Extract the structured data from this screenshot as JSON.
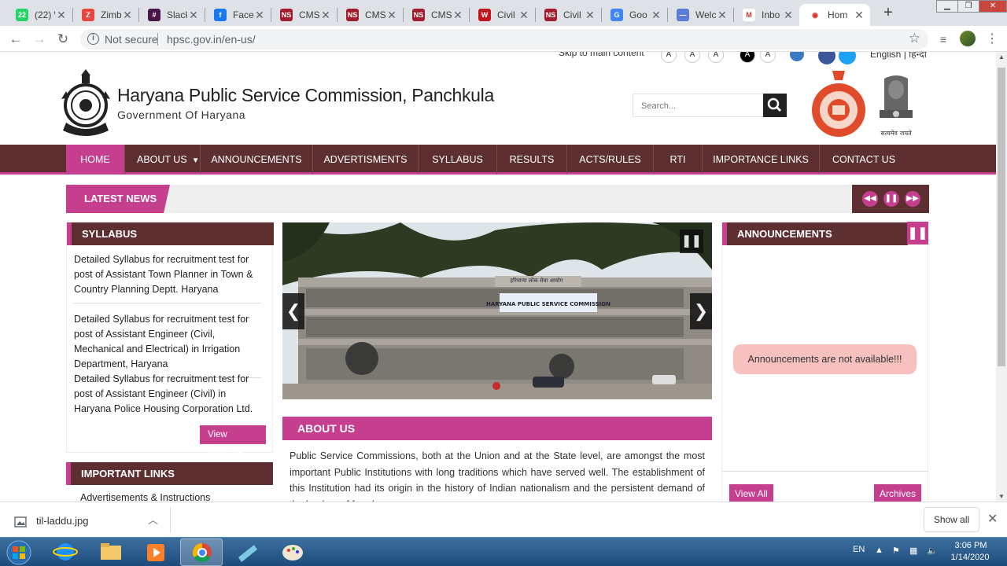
{
  "browser": {
    "tabs": [
      {
        "label": "(22) \\",
        "favicon_color": "#25d366",
        "favicon_text": "22"
      },
      {
        "label": "Zimb",
        "favicon_color": "#e8453c",
        "favicon_text": "Z"
      },
      {
        "label": "Slack",
        "favicon_color": "#4a154b",
        "favicon_text": "#"
      },
      {
        "label": "Facel",
        "favicon_color": "#1877f2",
        "favicon_text": "f"
      },
      {
        "label": "CMS",
        "favicon_color": "#a01c2c",
        "favicon_text": "NS"
      },
      {
        "label": "CMS",
        "favicon_color": "#a01c2c",
        "favicon_text": "NS"
      },
      {
        "label": "CMS",
        "favicon_color": "#a01c2c",
        "favicon_text": "NS"
      },
      {
        "label": "Civil",
        "favicon_color": "#c0161c",
        "favicon_text": "W"
      },
      {
        "label": "Civil",
        "favicon_color": "#a01c2c",
        "favicon_text": "NS"
      },
      {
        "label": "Goo",
        "favicon_color": "#4285f4",
        "favicon_text": "G"
      },
      {
        "label": "Welc",
        "favicon_color": "#5b7bd5",
        "favicon_text": "—"
      },
      {
        "label": "Inbo",
        "favicon_color": "#ffffff",
        "favicon_text": "M"
      },
      {
        "label": "Hom",
        "favicon_color": "#ffffff",
        "favicon_text": "◉"
      }
    ],
    "active_tab_index": 12,
    "address": {
      "security_label": "Not secure",
      "url": "hpsc.gov.in/en-us/"
    }
  },
  "site": {
    "topbar": {
      "skip_link": "Skip to main content",
      "font_buttons": [
        "A",
        "A",
        "A",
        "A",
        "A"
      ],
      "language": "English | हिन्दी"
    },
    "title": "Haryana Public Service Commission, Panchkula",
    "subtitle": "Government Of Haryana",
    "search_placeholder": "Search...",
    "emblem_caption": "सत्यमेव जयते",
    "nav": [
      "HOME",
      "ABOUT US",
      "ANNOUNCEMENTS",
      "ADVERTISMENTS",
      "SYLLABUS",
      "RESULTS",
      "ACTS/RULES",
      "RTI",
      "IMPORTANCE LINKS",
      "CONTACT US"
    ],
    "latest_news_label": "LATEST NEWS",
    "syllabus": {
      "heading": "SYLLABUS",
      "items": [
        "Detailed Syllabus for recruitment test for post of Assistant Town Planner in Town & Country Planning Deptt. Haryana",
        "Detailed Syllabus for recruitment test for post of Assistant Engineer (Civil, Mechanical and Electrical) in Irrigation Department, Haryana",
        "Detailed Syllabus for recruitment test for post of Assistant Engineer (Civil) in Haryana Police Housing Corporation Ltd."
      ],
      "view_more": "View More"
    },
    "important_links": {
      "heading": "IMPORTANT LINKS",
      "items": [
        "Advertisements & Instructions"
      ]
    },
    "slider": {
      "building_sign_hi": "हरियाणा लोक सेवा आयोग",
      "building_sign_en": "HARYANA PUBLIC SERVICE COMMISSION"
    },
    "about": {
      "heading": "ABOUT US",
      "text": "Public Service Commissions, both at the Union and at the State level, are amongst the most important Public Institutions with long traditions which have served well. The establishment of this Institution had its origin in the history of Indian nationalism and the persistent demand of the leaders of freedom"
    },
    "announcements": {
      "heading": "ANNOUNCEMENTS",
      "empty_message": "Announcements are not available!!!",
      "view_all": "View All",
      "archives": "Archives"
    }
  },
  "download_bar": {
    "file_name": "til-laddu.jpg",
    "show_all": "Show all"
  },
  "taskbar": {
    "language": "EN",
    "time": "3:06 PM",
    "date": "1/14/2020"
  },
  "colors": {
    "brand_maroon": "#5d2f30",
    "brand_pink": "#c63f8e",
    "notice_bg": "#f7c1c0"
  }
}
